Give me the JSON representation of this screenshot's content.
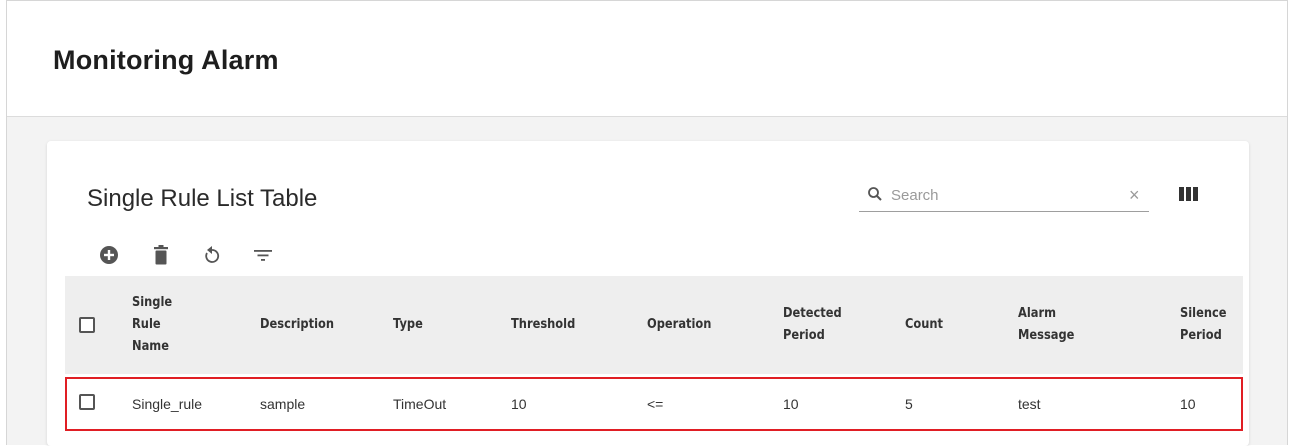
{
  "page": {
    "title": "Monitoring Alarm"
  },
  "card": {
    "title": "Single Rule List Table"
  },
  "search": {
    "placeholder": "Search",
    "value": ""
  },
  "toolbar": {
    "icons": [
      "add-icon",
      "delete-icon",
      "refresh-icon",
      "filter-icon"
    ]
  },
  "table": {
    "columns": [
      {
        "label_lines": [
          "Single",
          "Rule",
          "Name"
        ]
      },
      {
        "label_lines": [
          "Description"
        ]
      },
      {
        "label_lines": [
          "Type"
        ]
      },
      {
        "label_lines": [
          "Threshold"
        ]
      },
      {
        "label_lines": [
          "Operation"
        ]
      },
      {
        "label_lines": [
          "Detected",
          "Period"
        ]
      },
      {
        "label_lines": [
          "Count"
        ]
      },
      {
        "label_lines": [
          "Alarm",
          "Message"
        ]
      },
      {
        "label_lines": [
          "Silence",
          "Period"
        ]
      }
    ],
    "rows": [
      {
        "cells": [
          "Single_rule",
          "sample",
          "TimeOut",
          "10",
          "<=",
          "10",
          "5",
          "test",
          "10"
        ],
        "checked": false,
        "highlighted": true
      }
    ]
  },
  "colors": {
    "highlight_border": "#e01e24",
    "header_bg": "#eeeeee",
    "page_bg": "#f3f3f3"
  }
}
